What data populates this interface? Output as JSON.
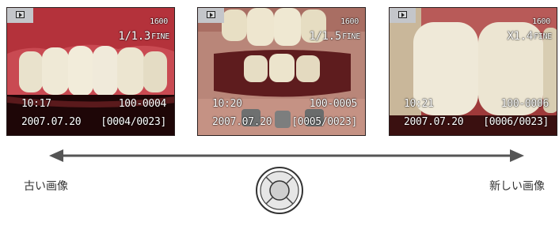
{
  "frames": [
    {
      "iso": "1600",
      "shutter": "1/1.3",
      "quality": "FINE",
      "time": "10:17",
      "file_number": "100-0004",
      "date": "2007.07.20",
      "image_count": "[0004/0023]"
    },
    {
      "iso": "1600",
      "shutter": "1/1.5",
      "quality": "FINE",
      "time": "10:20",
      "file_number": "100-0005",
      "date": "2007.07.20",
      "image_count": "[0005/0023]"
    },
    {
      "iso": "1600",
      "shutter": "X1.4",
      "quality": "FINE",
      "time": "10:21",
      "file_number": "100-0006",
      "date": "2007.07.20",
      "image_count": "[0006/0023]"
    }
  ],
  "navigation": {
    "older_label": "古い画像",
    "newer_label": "新しい画像"
  },
  "icons": {
    "playback": "play-mode-icon",
    "navigation": "four-way-controller-icon"
  },
  "colors": {
    "gum": "#c23b45",
    "tooth": "#ece6d2",
    "arrow": "#555555",
    "osd_text": "#ffffff",
    "play_badge": "#c4c6ca"
  }
}
